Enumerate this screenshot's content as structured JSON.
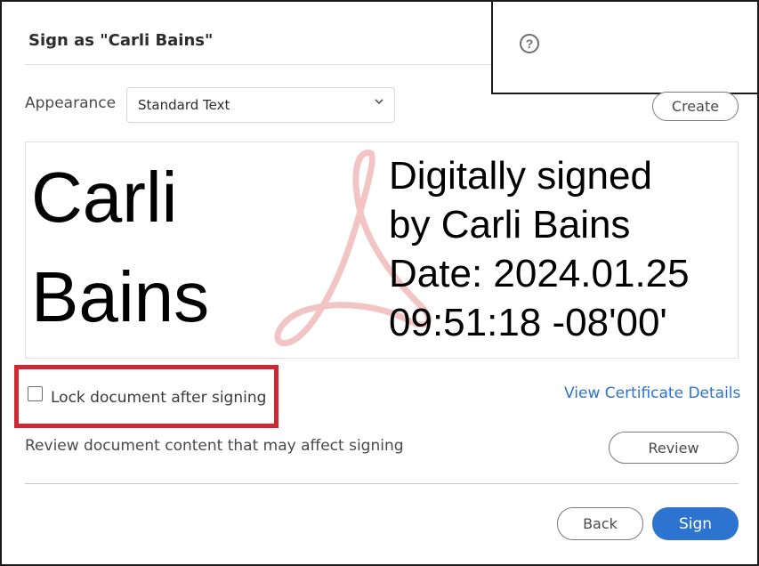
{
  "dialog": {
    "title": "Sign as \"Carli Bains\"",
    "help_symbol": "?"
  },
  "appearance": {
    "label": "Appearance",
    "selected": "Standard Text",
    "create_label": "Create"
  },
  "signature_preview": {
    "name_line1": "Carli",
    "name_line2": "Bains",
    "info_line1": "Digitally signed",
    "info_line2": "by Carli Bains",
    "info_line3": "Date: 2024.01.25",
    "info_line4": "09:51:18 -08'00'"
  },
  "options": {
    "lock_label": "Lock document after signing",
    "lock_checked": false,
    "certificate_link": "View Certificate Details",
    "review_text": "Review document content that may affect signing",
    "review_label": "Review"
  },
  "footer": {
    "back_label": "Back",
    "sign_label": "Sign"
  },
  "colors": {
    "accent": "#2c74cf",
    "highlight": "#cf2832",
    "logo_tint": "#f2c4c4"
  }
}
